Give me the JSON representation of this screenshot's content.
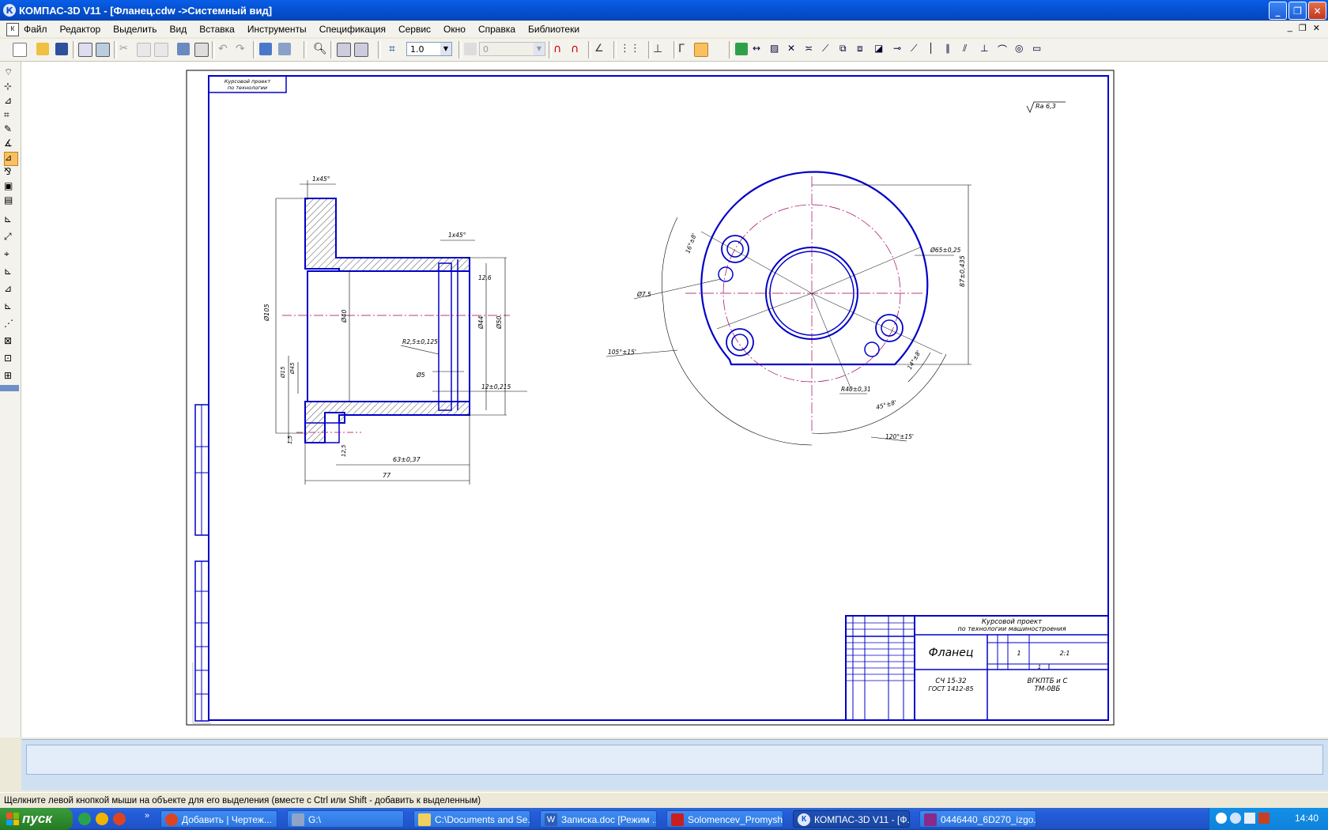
{
  "window": {
    "title": "КОМПАС-3D V11 - [Фланец.cdw ->Системный вид]",
    "app_icon": "К",
    "buttons": [
      "minimize-icon",
      "restore-icon",
      "close-icon"
    ]
  },
  "menu": {
    "items": [
      "Файл",
      "Редактор",
      "Выделить",
      "Вид",
      "Вставка",
      "Инструменты",
      "Спецификация",
      "Сервис",
      "Окно",
      "Справка",
      "Библиотеки"
    ],
    "mdi_buttons": [
      "_",
      "❐",
      "✕"
    ]
  },
  "toolbar": {
    "scale_value": "1.0",
    "layer_value": "0"
  },
  "drawing": {
    "top_label_line1": "Курсовой проект",
    "top_label_line2": "по технологии",
    "roughness": "Ra 6,3",
    "dim_chamfer1": "1х45°",
    "dim_chamfer2": "1х45°",
    "dim_d105": "Ø105",
    "dim_d45": "Ø45",
    "dim_d15": "Ø15",
    "dim_d40": "Ø40",
    "dim_d44": "Ø44",
    "dim_d50": "Ø50",
    "dim_r25": "R2,5±0,125",
    "dim_d5": "Ø5",
    "dim_126": "12,6",
    "dim_12": "12±0,215",
    "dim_125": "12,5",
    "dim_15": "1,5",
    "dim_63": "63±0,37",
    "dim_77": "77",
    "dim_d75": "Ø7,5",
    "dim_105deg": "105°±15'",
    "dim_d65": "Ø65±0,25",
    "dim_87": "87±0,435",
    "dim_16deg": "16°±8'",
    "dim_r40": "R40±0,31",
    "dim_45deg": "45°±8'",
    "dim_120deg": "120°±15'",
    "dim_14deg": "14°±8'",
    "tb_project_line1": "Курсовой проект",
    "tb_project_line2": "по технологии машиностроения",
    "tb_part_name": "Фланец",
    "tb_material_line1": "СЧ 15-32",
    "tb_material_line2": "ГОСТ 1412-85",
    "tb_org_line1": "ВГКПТБ и С",
    "tb_org_line2": "ТМ-0ВБ",
    "tb_sheet": "1",
    "tb_scale": "2:1",
    "tb_mass": "1"
  },
  "status_text": "Щелкните левой кнопкой мыши на объекте для его выделения (вместе с Ctrl или Shift - добавить к выделенным)",
  "taskbar": {
    "start_label": "пуск",
    "tasks": [
      {
        "label": "Добавить | Чертеж...",
        "icon": "chrome-icon"
      },
      {
        "label": "G:\\",
        "icon": "drive-icon"
      },
      {
        "label": "C:\\Documents and Se...",
        "icon": "folder-icon"
      },
      {
        "label": "Записка.doc [Режим ...",
        "icon": "word-icon"
      },
      {
        "label": "Solomencev_Promysh...",
        "icon": "pdf-icon"
      },
      {
        "label": "КОМПАС-3D V11 - [Ф...",
        "icon": "kompas-icon"
      },
      {
        "label": "0446440_6D270_izgo...",
        "icon": "winrar-icon"
      }
    ],
    "language": "EN",
    "clock": "14:40"
  },
  "colors": {
    "drawing_blue": "#0000c8",
    "axis_magenta": "#a00060",
    "thin_black": "#000000",
    "taskbar_blue": "#245edb",
    "start_green": "#2f8b2f"
  }
}
